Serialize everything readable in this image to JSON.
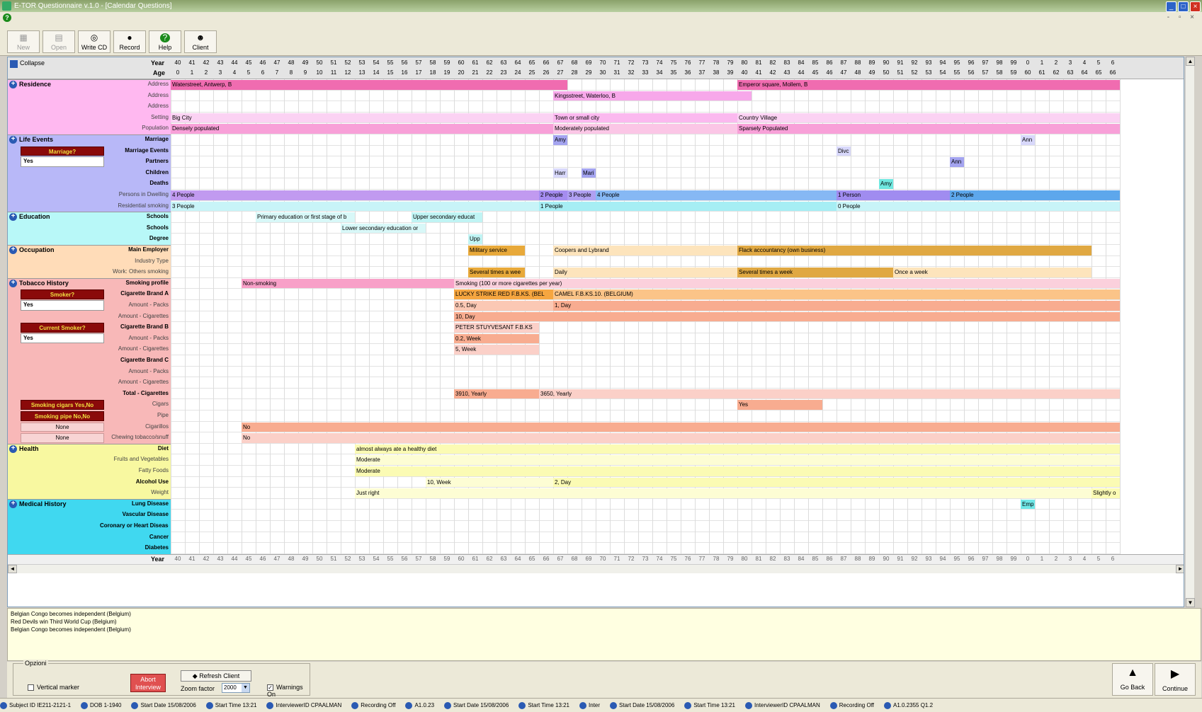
{
  "window": {
    "title": "E-TOR Questionnaire v.1.0 - [Calendar Questions]"
  },
  "toolbar": [
    {
      "label": "New",
      "icon": "new-icon",
      "enabled": false
    },
    {
      "label": "Open",
      "icon": "open-icon",
      "enabled": false
    },
    {
      "label": "Write CD",
      "icon": "write-cd-icon",
      "enabled": true
    },
    {
      "label": "Record",
      "icon": "record-icon",
      "enabled": true
    },
    {
      "label": "Help",
      "icon": "help-icon",
      "enabled": true
    },
    {
      "label": "Client",
      "icon": "client-icon",
      "enabled": true
    }
  ],
  "grid": {
    "collapse_label": "Collapse",
    "year_label": "Year",
    "age_label": "Age",
    "years": [
      "40",
      "41",
      "42",
      "43",
      "44",
      "45",
      "46",
      "47",
      "48",
      "49",
      "50",
      "51",
      "52",
      "53",
      "54",
      "55",
      "56",
      "57",
      "58",
      "59",
      "60",
      "61",
      "62",
      "63",
      "64",
      "65",
      "66",
      "67",
      "68",
      "69",
      "70",
      "71",
      "72",
      "73",
      "74",
      "75",
      "76",
      "77",
      "78",
      "79",
      "80",
      "81",
      "82",
      "83",
      "84",
      "85",
      "86",
      "87",
      "88",
      "89",
      "90",
      "91",
      "92",
      "93",
      "94",
      "95",
      "96",
      "97",
      "98",
      "99",
      "0",
      "1",
      "2",
      "3",
      "4",
      "5",
      "6"
    ],
    "ages": [
      "0",
      "1",
      "2",
      "3",
      "4",
      "5",
      "6",
      "7",
      "8",
      "9",
      "10",
      "11",
      "12",
      "13",
      "14",
      "15",
      "16",
      "17",
      "18",
      "19",
      "20",
      "21",
      "22",
      "23",
      "24",
      "25",
      "26",
      "27",
      "28",
      "29",
      "30",
      "31",
      "32",
      "33",
      "34",
      "35",
      "36",
      "37",
      "38",
      "39",
      "40",
      "41",
      "42",
      "43",
      "44",
      "45",
      "46",
      "47",
      "48",
      "49",
      "50",
      "51",
      "52",
      "53",
      "54",
      "55",
      "56",
      "57",
      "58",
      "59",
      "60",
      "61",
      "62",
      "63",
      "64",
      "65",
      "66"
    ],
    "sections": [
      {
        "name": "Residence",
        "bg": "#ffb8f0",
        "rows": [
          {
            "label": "Address",
            "bold": false,
            "bars": [
              {
                "s": 0,
                "e": 28,
                "text": "Waterstreet, Antwerp, B",
                "color": "#f06cb0"
              },
              {
                "s": 40,
                "e": 67,
                "text": "Emperor square, Mollem, B",
                "color": "#f06cb0"
              }
            ]
          },
          {
            "label": "Address",
            "bold": false,
            "bars": [
              {
                "s": 27,
                "e": 41,
                "text": "Kingsstreet, Waterloo, B",
                "color": "#f7a8ea"
              }
            ]
          },
          {
            "label": "Address",
            "bold": false,
            "bars": []
          },
          {
            "label": "Setting",
            "bold": false,
            "bars": [
              {
                "s": 0,
                "e": 27,
                "text": "Big City",
                "color": "#fbd2f3"
              },
              {
                "s": 27,
                "e": 40,
                "text": "Town or small city",
                "color": "#fbb9ef"
              },
              {
                "s": 40,
                "e": 67,
                "text": "Country Village",
                "color": "#fbd2f3"
              }
            ]
          },
          {
            "label": "Population",
            "bold": false,
            "bars": [
              {
                "s": 0,
                "e": 27,
                "text": "Densely populated",
                "color": "#f8a0d8"
              },
              {
                "s": 27,
                "e": 40,
                "text": "Moderately populated",
                "color": "#fbc6e6"
              },
              {
                "s": 40,
                "e": 67,
                "text": "Sparsely Populated",
                "color": "#f8a0d8"
              }
            ]
          }
        ]
      },
      {
        "name": "Life Events",
        "bg": "#b8b8f8",
        "rows": [
          {
            "label": "Marriage",
            "bold": true,
            "bars": [
              {
                "s": 27,
                "e": 28,
                "text": "Amy",
                "color": "#a4a4f0"
              },
              {
                "s": 60,
                "e": 61,
                "text": "Ann",
                "color": "#d8d8fb"
              }
            ]
          },
          {
            "label": "Marriage Events",
            "bold": true,
            "bars": [
              {
                "s": 47,
                "e": 48,
                "text": "Divc",
                "color": "#d8d8fb"
              }
            ]
          },
          {
            "label": "Partners",
            "bold": true,
            "bars": [
              {
                "s": 55,
                "e": 56,
                "text": "Ann",
                "color": "#a4a4f0"
              }
            ]
          },
          {
            "label": "Children",
            "bold": true,
            "bars": [
              {
                "s": 27,
                "e": 28,
                "text": "Harr",
                "color": "#d8d8fb"
              },
              {
                "s": 29,
                "e": 30,
                "text": "Mari",
                "color": "#a4a4f0"
              }
            ]
          },
          {
            "label": "Deaths",
            "bold": true,
            "bars": [
              {
                "s": 50,
                "e": 51,
                "text": "Amy",
                "color": "#70e8e0"
              }
            ]
          },
          {
            "label": "Persons in Dwelling",
            "bold": false,
            "bars": [
              {
                "s": 0,
                "e": 26,
                "text": "4 People",
                "color": "#c19af0"
              },
              {
                "s": 26,
                "e": 28,
                "text": "2 People",
                "color": "#a58cf0"
              },
              {
                "s": 28,
                "e": 30,
                "text": "3 People",
                "color": "#b0a0f2"
              },
              {
                "s": 30,
                "e": 47,
                "text": "4 People",
                "color": "#86b8f4"
              },
              {
                "s": 47,
                "e": 55,
                "text": "1 Person",
                "color": "#a08cf0"
              },
              {
                "s": 55,
                "e": 67,
                "text": "2 People",
                "color": "#5da7ec"
              }
            ]
          },
          {
            "label": "Residential smoking",
            "bold": false,
            "bars": [
              {
                "s": 0,
                "e": 26,
                "text": "3 People",
                "color": "#c8f4f8"
              },
              {
                "s": 26,
                "e": 47,
                "text": "1 People",
                "color": "#a6eef4"
              },
              {
                "s": 47,
                "e": 67,
                "text": "0 People",
                "color": "#c8f4f8"
              }
            ]
          }
        ]
      },
      {
        "name": "Education",
        "bg": "#b8f8f8",
        "rows": [
          {
            "label": "Schools",
            "bold": true,
            "bars": [
              {
                "s": 6,
                "e": 13,
                "text": "Primary education or first stage of b",
                "color": "#d8f8f8"
              },
              {
                "s": 17,
                "e": 22,
                "text": "Upper secondary educat",
                "color": "#c0f4f4"
              }
            ]
          },
          {
            "label": "Schools",
            "bold": true,
            "bars": [
              {
                "s": 12,
                "e": 18,
                "text": "Lower secondary education or",
                "color": "#d8f8f8"
              }
            ]
          },
          {
            "label": "Degree",
            "bold": true,
            "bars": [
              {
                "s": 21,
                "e": 22,
                "text": "Upp",
                "color": "#c0f4f4"
              }
            ]
          }
        ]
      },
      {
        "name": "Occupation",
        "bg": "#ffdcb8",
        "rows": [
          {
            "label": "Main Employer",
            "bold": true,
            "bars": [
              {
                "s": 21,
                "e": 25,
                "text": "Military service",
                "color": "#e8a93a"
              },
              {
                "s": 27,
                "e": 40,
                "text": "Coopers and Lybrand",
                "color": "#fde4bc"
              },
              {
                "s": 40,
                "e": 65,
                "text": "Flack accountancy (own business)",
                "color": "#e0a842"
              }
            ]
          },
          {
            "label": "Industry Type",
            "bold": false,
            "bars": []
          },
          {
            "label": "Work: Others smoking",
            "bold": false,
            "bars": [
              {
                "s": 21,
                "e": 25,
                "text": "Several times a wee",
                "color": "#e8a93a"
              },
              {
                "s": 27,
                "e": 40,
                "text": "Daily",
                "color": "#fde4bc"
              },
              {
                "s": 40,
                "e": 51,
                "text": "Several times a week",
                "color": "#e0a842"
              },
              {
                "s": 51,
                "e": 65,
                "text": "Once a week",
                "color": "#fde4bc"
              }
            ]
          }
        ]
      },
      {
        "name": "Tobacco History",
        "bg": "#f8b8b8",
        "rows": [
          {
            "label": "Smoking profile",
            "bold": true,
            "bars": [
              {
                "s": 5,
                "e": 20,
                "text": "Non-smoking",
                "color": "#f8a0c8"
              },
              {
                "s": 20,
                "e": 67,
                "text": "Smoking (100 or more cigarettes per year)",
                "color": "#fbd0dc"
              }
            ]
          },
          {
            "label": "Cigarette Brand A",
            "bold": true,
            "bars": [
              {
                "s": 20,
                "e": 27,
                "text": "LUCKY STRIKE RED F.B.KS. (BEL",
                "color": "#f6a640"
              },
              {
                "s": 27,
                "e": 67,
                "text": "CAMEL F.B.KS.10. (BELGIUM)",
                "color": "#fbc488"
              }
            ]
          },
          {
            "label": "Amount - Packs",
            "bold": false,
            "bars": [
              {
                "s": 20,
                "e": 27,
                "text": "0.5, Day",
                "color": "#fbc8b4"
              },
              {
                "s": 27,
                "e": 67,
                "text": "1, Day",
                "color": "#f8ac90"
              }
            ]
          },
          {
            "label": "Amount - Cigarettes",
            "bold": false,
            "bars": [
              {
                "s": 20,
                "e": 67,
                "text": "10, Day",
                "color": "#f8ac90"
              }
            ]
          },
          {
            "label": "Cigarette Brand B",
            "bold": true,
            "bars": [
              {
                "s": 20,
                "e": 26,
                "text": "PETER STUYVESANT F.B.KS",
                "color": "#fbd0c8"
              }
            ]
          },
          {
            "label": "Amount - Packs",
            "bold": false,
            "bars": [
              {
                "s": 20,
                "e": 26,
                "text": "0.2, Week",
                "color": "#f8ac90"
              }
            ]
          },
          {
            "label": "Amount - Cigarettes",
            "bold": false,
            "bars": [
              {
                "s": 20,
                "e": 26,
                "text": "5, Week",
                "color": "#fbd0c8"
              }
            ]
          },
          {
            "label": "Cigarette Brand C",
            "bold": true,
            "bars": []
          },
          {
            "label": "Amount - Packs",
            "bold": false,
            "bars": []
          },
          {
            "label": "Amount - Cigarettes",
            "bold": false,
            "bars": []
          },
          {
            "label": "Total - Cigarettes",
            "bold": true,
            "bars": [
              {
                "s": 20,
                "e": 26,
                "text": "3910, Yearly",
                "color": "#f8ac90"
              },
              {
                "s": 26,
                "e": 67,
                "text": "3650, Yearly",
                "color": "#fbd0c8"
              }
            ]
          },
          {
            "label": "Cigars",
            "bold": false,
            "bars": [
              {
                "s": 40,
                "e": 46,
                "text": "Yes",
                "color": "#f8ac90"
              }
            ]
          },
          {
            "label": "Pipe",
            "bold": false,
            "bars": []
          },
          {
            "label": "Cigarillos",
            "bold": false,
            "bars": [
              {
                "s": 5,
                "e": 67,
                "text": "No",
                "color": "#f8ac90"
              }
            ]
          },
          {
            "label": "Chewing tobacco/snuff",
            "bold": false,
            "bars": [
              {
                "s": 5,
                "e": 67,
                "text": "No",
                "color": "#fbd0c8"
              }
            ]
          }
        ]
      },
      {
        "name": "Health",
        "bg": "#f8f8a0",
        "rows": [
          {
            "label": "Diet",
            "bold": true,
            "bars": [
              {
                "s": 13,
                "e": 67,
                "text": "almost always ate a healthy diet",
                "color": "#fbfbb4"
              }
            ]
          },
          {
            "label": "Fruits and Vegetables",
            "bold": false,
            "bars": [
              {
                "s": 13,
                "e": 67,
                "text": "Moderate",
                "color": "#fdfdd4"
              }
            ]
          },
          {
            "label": "Fatty Foods",
            "bold": false,
            "bars": [
              {
                "s": 13,
                "e": 67,
                "text": "Moderate",
                "color": "#fbfbb4"
              }
            ]
          },
          {
            "label": "Alcohol Use",
            "bold": true,
            "bars": [
              {
                "s": 18,
                "e": 27,
                "text": "10, Week",
                "color": "#fdfdd4"
              },
              {
                "s": 27,
                "e": 67,
                "text": "2, Day",
                "color": "#fbfbb4"
              }
            ]
          },
          {
            "label": "Weight",
            "bold": false,
            "bars": [
              {
                "s": 13,
                "e": 65,
                "text": "Just right",
                "color": "#fdfdd4"
              },
              {
                "s": 65,
                "e": 67,
                "text": "Slightly o",
                "color": "#fbfbb4"
              }
            ]
          }
        ]
      },
      {
        "name": "Medical History",
        "bg": "#40d8f0",
        "rows": [
          {
            "label": "Lung Disease",
            "bold": true,
            "bars": [
              {
                "s": 60,
                "e": 61,
                "text": "Emp",
                "color": "#70e8e8"
              }
            ]
          },
          {
            "label": "Vascular Disease",
            "bold": true,
            "bars": []
          },
          {
            "label": "Coronary or Heart Disease",
            "bold": true,
            "bars": []
          },
          {
            "label": "Cancer",
            "bold": true,
            "bars": []
          },
          {
            "label": "Diabetes",
            "bold": true,
            "bars": []
          }
        ]
      }
    ],
    "questions": [
      {
        "section": 1,
        "label": "Marriage?",
        "answer": "Yes"
      },
      {
        "section": 4,
        "label": "Smoker?",
        "answer": "Yes",
        "row": 1
      },
      {
        "section": 4,
        "label": "Current Smoker?",
        "answer": "Yes",
        "row": 4
      },
      {
        "section": 4,
        "label": "Smoking cigars Yes,No",
        "answer": "",
        "row": 11,
        "small": true
      },
      {
        "section": 4,
        "label": "Smoking pipe No,No",
        "answer": "",
        "row": 12,
        "small": true
      },
      {
        "section": 4,
        "label": "None",
        "answer": "",
        "row": 13,
        "plain": true
      },
      {
        "section": 4,
        "label": "None",
        "answer": "",
        "row": 14,
        "plain": true
      }
    ]
  },
  "events": {
    "lines": [
      "Belgian Congo becomes independent (Belgium)",
      "Red Devils win Third World Cup (Belgium)",
      "Belgian Congo becomes independent (Belgium)"
    ]
  },
  "options": {
    "group_label": "Opzioni",
    "vertical_marker": "Vertical marker",
    "abort_label": "Abort Interview",
    "refresh_label": "Refresh Client",
    "zoom_label": "Zoom factor",
    "zoom_value": "2000",
    "warnings_label": "Warnings On",
    "go_back": "Go Back",
    "continue": "Continue"
  },
  "status": {
    "items": [
      "Subject ID IE211-2121-1",
      "DOB 1-1940",
      "Start Date 15/08/2006",
      "Start Time 13:21",
      "InterviewerID CPAALMAN",
      "Recording Off",
      "A1.0.23",
      "Start Date 15/08/2006",
      "Start Time 13:21",
      "Inter",
      "Start Date 15/08/2006",
      "Start Time 13:21",
      "InterviewerID CPAALMAN",
      "Recording Off",
      "A1.0.2355 Q1.2"
    ]
  }
}
